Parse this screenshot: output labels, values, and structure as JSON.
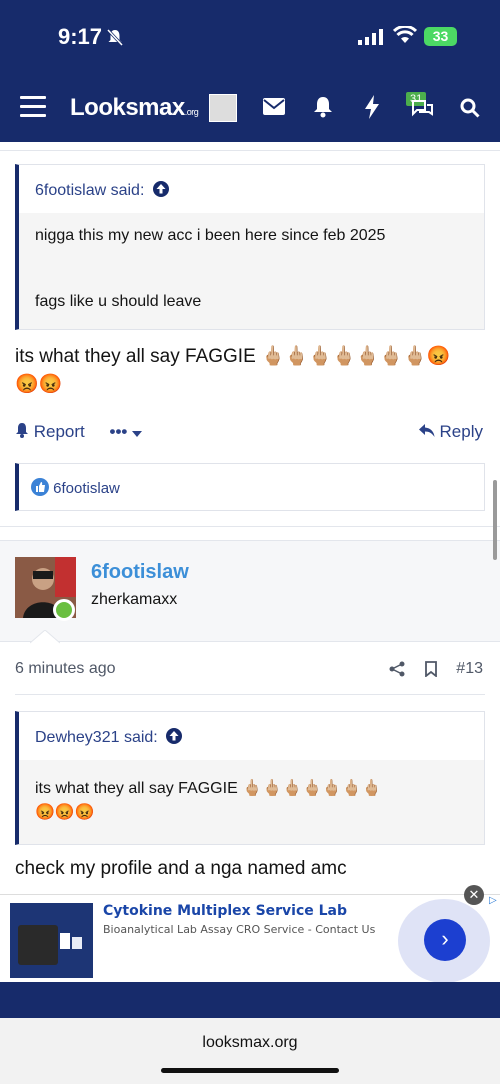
{
  "status": {
    "time": "9:17",
    "battery": "33"
  },
  "nav": {
    "logo": "Looksmax",
    "logo_suffix": ".org",
    "conversations_badge": "31"
  },
  "post1": {
    "quote_author": "6footislaw said:",
    "quote_line1": "nigga this my new acc i been here since feb 2025",
    "quote_line2": "fags like u should leave",
    "text": "its what they all say FAGGIE 🖕🏼🖕🏼🖕🏼🖕🏼🖕🏼🖕🏼🖕🏼😡",
    "text_line2": "😡😡",
    "report_label": "Report",
    "more_label": "•••",
    "reply_label": "Reply",
    "reaction_user": "6footislaw"
  },
  "post2": {
    "username": "6footislaw",
    "user_title": "zherkamaxx",
    "time": "6 minutes ago",
    "number": "#13",
    "quote_author": "Dewhey321 said:",
    "quote_line1": "its what they all say FAGGIE 🖕🏼🖕🏼🖕🏼🖕🏼🖕🏼🖕🏼🖕🏼",
    "quote_line2": "😡😡😡",
    "text": "check my profile and a nga named amc"
  },
  "ad": {
    "title": "Cytokine Multiplex Service Lab",
    "subtitle": "Bioanalytical Lab Assay CRO Service - Contact Us",
    "cta": "›",
    "close": "✕",
    "choices": "▷"
  },
  "browser": {
    "url": "looksmax.org"
  }
}
